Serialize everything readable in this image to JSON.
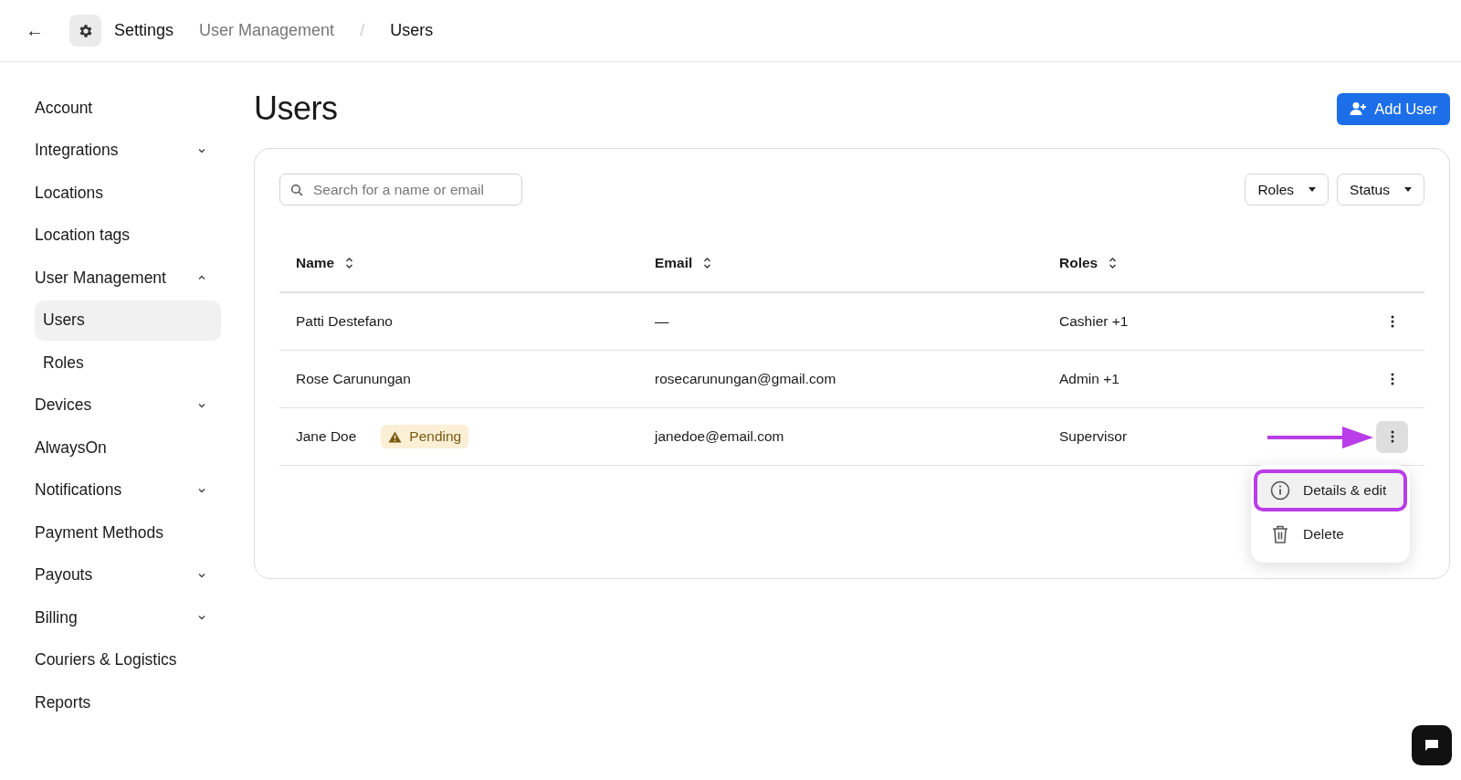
{
  "header": {
    "back_button": "←",
    "breadcrumbs": [
      {
        "label": "Settings",
        "kind": "root"
      },
      {
        "label": "User Management",
        "kind": "parent"
      },
      {
        "label": "Users",
        "kind": "current"
      }
    ],
    "separator": "/"
  },
  "sidebar": {
    "items": [
      {
        "label": "Account",
        "kind": "link",
        "selected": false
      },
      {
        "label": "Integrations",
        "kind": "group",
        "expanded": false
      },
      {
        "label": "Locations",
        "kind": "link",
        "selected": false
      },
      {
        "label": "Location tags",
        "kind": "link",
        "selected": false
      },
      {
        "label": "User Management",
        "kind": "group",
        "expanded": true,
        "children": [
          {
            "label": "Users",
            "selected": true
          },
          {
            "label": "Roles",
            "selected": false
          }
        ]
      },
      {
        "label": "Devices",
        "kind": "group",
        "expanded": false
      },
      {
        "label": "AlwaysOn",
        "kind": "link",
        "selected": false
      },
      {
        "label": "Notifications",
        "kind": "group",
        "expanded": false
      },
      {
        "label": "Payment Methods",
        "kind": "link",
        "selected": false
      },
      {
        "label": "Payouts",
        "kind": "group",
        "expanded": false
      },
      {
        "label": "Billing",
        "kind": "group",
        "expanded": false
      },
      {
        "label": "Couriers & Logistics",
        "kind": "link",
        "selected": false
      },
      {
        "label": "Reports",
        "kind": "link",
        "selected": false
      }
    ]
  },
  "page": {
    "title": "Users",
    "add_button": "Add User"
  },
  "filters": {
    "search": {
      "placeholder": "Search for a name or email"
    },
    "dropdowns": [
      "Roles",
      "Status"
    ]
  },
  "table": {
    "columns": [
      "Name",
      "Email",
      "Roles"
    ],
    "rows": [
      {
        "name": "Patti Destefano",
        "status": null,
        "email": "—",
        "roles": "Cashier +1",
        "menu_open": false
      },
      {
        "name": "Rose Carunungan",
        "status": null,
        "email": "rosecarunungan@gmail.com",
        "roles": "Admin +1",
        "menu_open": false
      },
      {
        "name": "Jane Doe",
        "status": "Pending",
        "email": "janedoe@email.com",
        "roles": "Supervisor",
        "menu_open": true
      }
    ]
  },
  "row_menu": {
    "items": [
      {
        "label": "Details & edit",
        "highlighted": true
      },
      {
        "label": "Delete",
        "highlighted": false
      }
    ]
  }
}
